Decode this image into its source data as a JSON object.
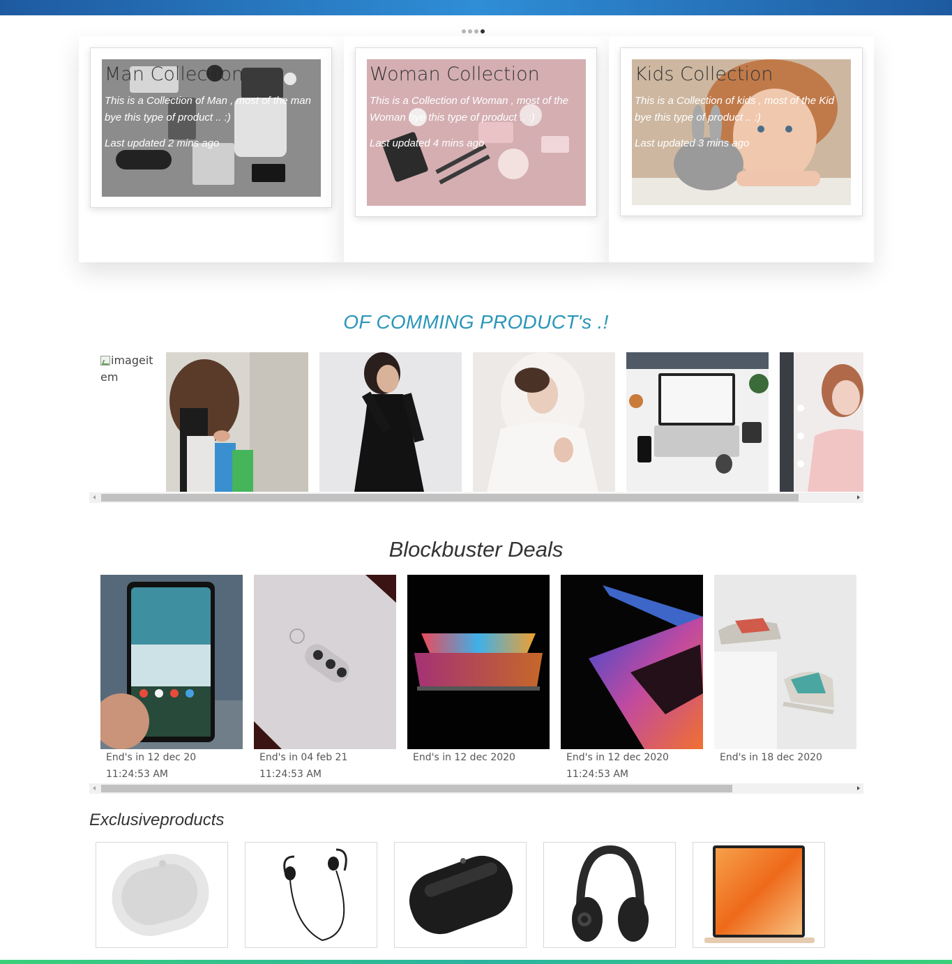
{
  "collections": [
    {
      "title": "Man Collection",
      "description": "This is a Collection of Man , most of the man bye this type of product .. :)",
      "updated": "Last updated 2 mins ago"
    },
    {
      "title": "Woman Collection",
      "description": "This is a Collection of Woman , most of the Woman bye this type of product .. :)",
      "updated": "Last updated 4 mins ago"
    },
    {
      "title": "Kids Collection",
      "description": "This is a Collection of kids , most of the Kid bye this type of product .. :)",
      "updated": "Last updated 3 mins ago"
    }
  ],
  "upcoming": {
    "title": "OF COMMING PRODUCT's .!",
    "broken_image_alt": "imageitem"
  },
  "deals": {
    "title": "Blockbuster Deals",
    "items": [
      {
        "ends": "End's in 12 dec 20",
        "time": "11:24:53 AM"
      },
      {
        "ends": "End's in 04 feb 21",
        "time": "11:24:53 AM"
      },
      {
        "ends": "End's in 12 dec 2020",
        "time": ""
      },
      {
        "ends": "End's in 12 dec 2020",
        "time": "11:24:53 AM"
      },
      {
        "ends": "End's in 18 dec 2020",
        "time": ""
      }
    ]
  },
  "exclusive": {
    "title": "Exclusiveproducts"
  }
}
